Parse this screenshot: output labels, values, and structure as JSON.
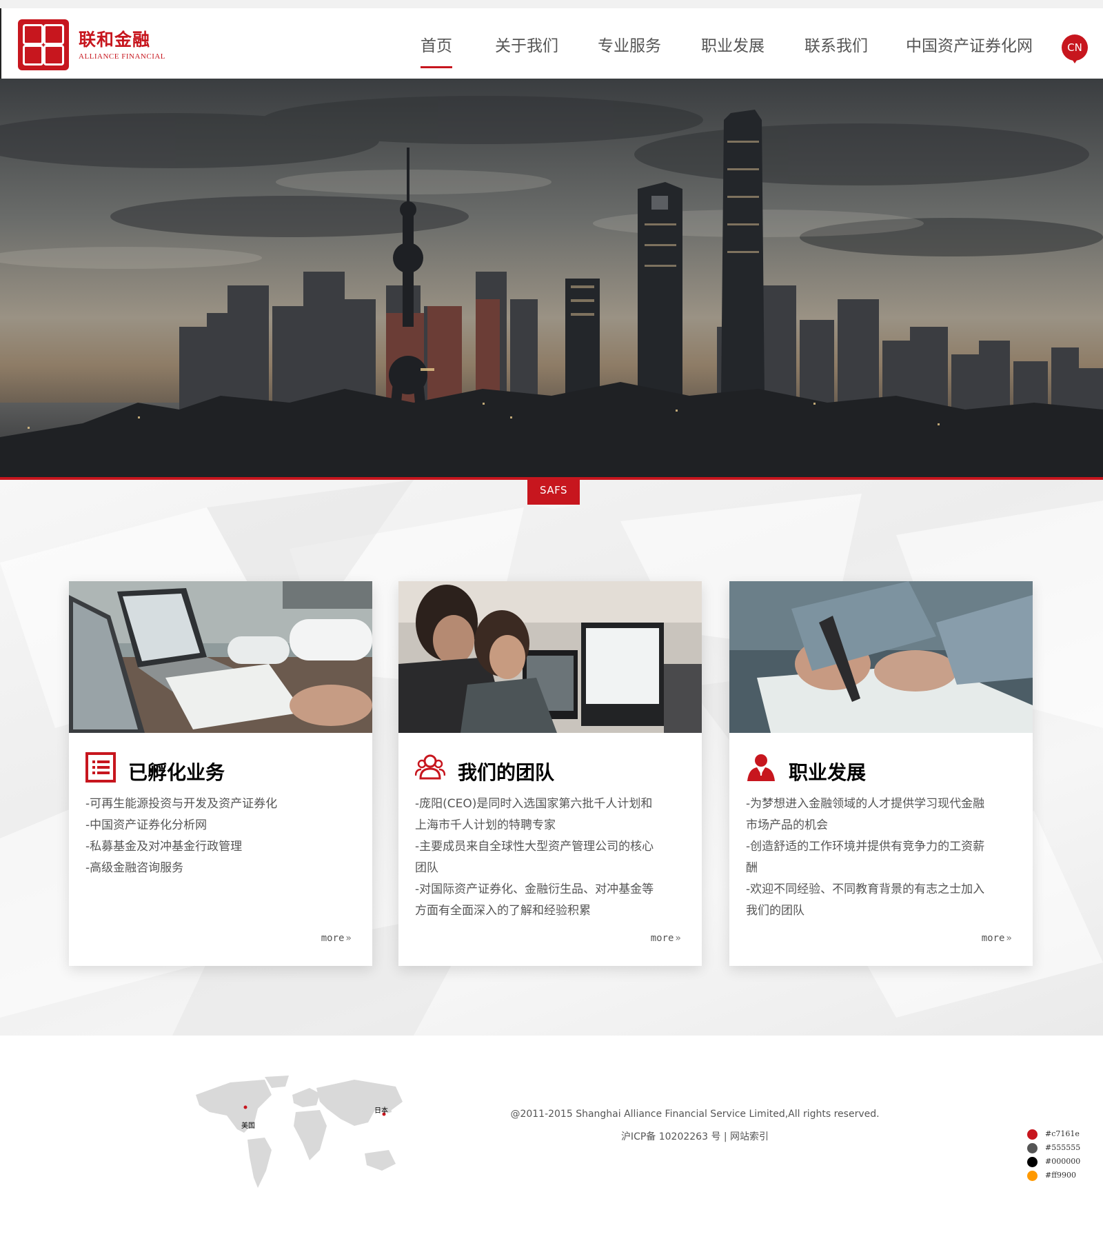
{
  "brand": {
    "name_cn": "联和金融",
    "name_en": "ALLIANCE FINANCIAL",
    "seal_color": "#c7161e"
  },
  "nav": {
    "items": [
      {
        "label": "首页",
        "active": true
      },
      {
        "label": "关于我们",
        "active": false
      },
      {
        "label": "专业服务",
        "active": false
      },
      {
        "label": "职业发展",
        "active": false
      },
      {
        "label": "联系我们",
        "active": false
      },
      {
        "label": "中国资产证券化网",
        "active": false
      }
    ],
    "language": "CN"
  },
  "hero": {
    "image": "shanghai-skyline-at-dusk",
    "tag": "SAFS"
  },
  "cards": [
    {
      "icon": "list-icon",
      "title": "已孵化业务",
      "lines": [
        "-可再生能源投资与开发及资产证券化",
        "-中国资产证券化分析网",
        "-私募基金及对冲基金行政管理",
        "-高级金融咨询服务"
      ],
      "more": "more"
    },
    {
      "icon": "team-icon",
      "title": "我们的团队",
      "lines": [
        "-庞阳(CEO)是同时入选国家第六批千人计划和",
        " 上海市千人计划的特聘专家",
        "-主要成员来自全球性大型资产管理公司的核心",
        " 团队",
        "-对国际资产证券化、金融衍生品、对冲基金等",
        " 方面有全面深入的了解和经验积累"
      ],
      "more": "more"
    },
    {
      "icon": "person-icon",
      "title": "职业发展",
      "lines": [
        "-为梦想进入金融领域的人才提供学习现代金融",
        " 市场产品的机会",
        "-创造舒适的工作环境并提供有竞争力的工资薪",
        " 酬",
        "-欢迎不同经验、不同教育背景的有志之士加入",
        " 我们的团队"
      ],
      "more": "more"
    }
  ],
  "footer": {
    "map": {
      "label_us": "美国",
      "label_jp": "日本"
    },
    "copyright": "@2011-2015 Shanghai Alliance Financial Service Limited,All rights reserved.",
    "icp": "沪ICP备 10202263 号 | 网站索引"
  },
  "palette": [
    {
      "hex": "#c7161e"
    },
    {
      "hex": "#555555"
    },
    {
      "hex": "#000000"
    },
    {
      "hex": "#ff9900"
    }
  ]
}
